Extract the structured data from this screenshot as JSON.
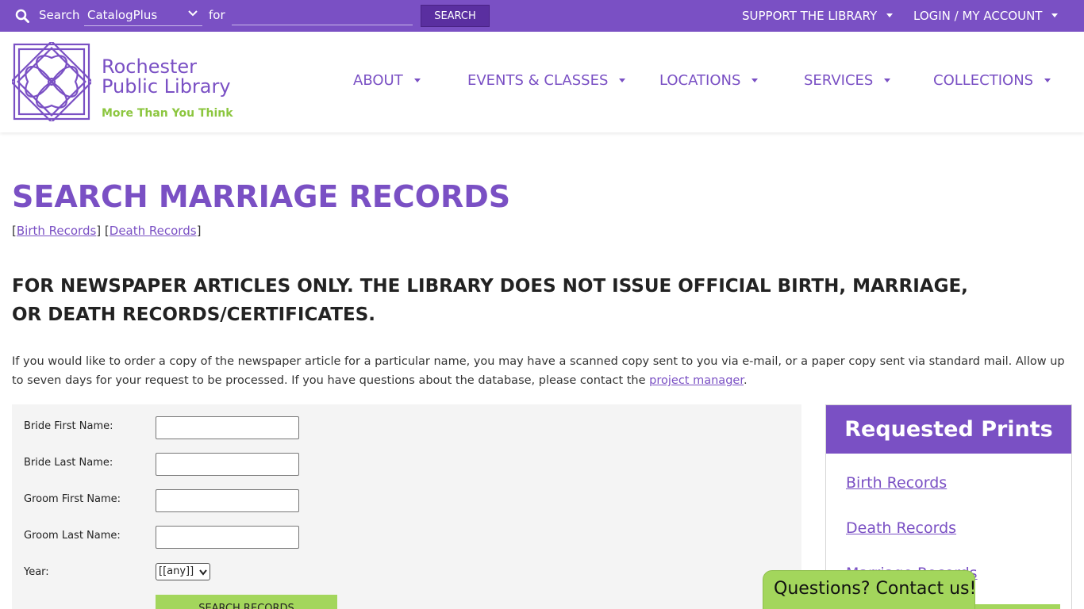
{
  "topbar": {
    "search_label": "Search",
    "catalog_value": "CatalogPlus",
    "for_label": "for",
    "query_value": "",
    "search_button": "SEARCH",
    "support_link": "SUPPORT THE LIBRARY",
    "login_link": "LOGIN / MY ACCOUNT"
  },
  "header": {
    "logo_line1": "Rochester",
    "logo_line2": "Public Library",
    "tagline": "More Than You Think",
    "nav": [
      "ABOUT",
      "EVENTS & CLASSES",
      "LOCATIONS",
      "SERVICES",
      "COLLECTIONS"
    ]
  },
  "main": {
    "title": "SEARCH MARRIAGE RECORDS",
    "birth_link": "Birth Records",
    "death_link": "Death Records",
    "notice": "FOR NEWSPAPER ARTICLES ONLY. THE LIBRARY DOES NOT ISSUE OFFICIAL BIRTH, MARRIAGE, OR DEATH RECORDS/CERTIFICATES.",
    "intro_text": "If you would like to order a copy of the newspaper article for a particular name, you may have a scanned copy sent to you via e-mail, or a paper copy sent via standard mail. Allow up to seven days for your request to be processed. If you have questions about the database, please contact the ",
    "intro_link": "project manager",
    "intro_end": "."
  },
  "form": {
    "bride_first_label": "Bride First Name:",
    "bride_last_label": "Bride Last Name:",
    "groom_first_label": "Groom First Name:",
    "groom_last_label": "Groom Last Name:",
    "year_label": "Year:",
    "year_value": "[[any]]",
    "submit_label": "SEARCH RECORDS"
  },
  "sidebar": {
    "title": "Requested Prints",
    "links": [
      "Birth Records",
      "Death Records",
      "Marriage Records"
    ]
  },
  "chat": {
    "label": "Questions? Contact us!"
  },
  "colors": {
    "brand_purple": "#7a50c4",
    "brand_green": "#a3d65c",
    "tagline_green": "#8cc63f"
  }
}
